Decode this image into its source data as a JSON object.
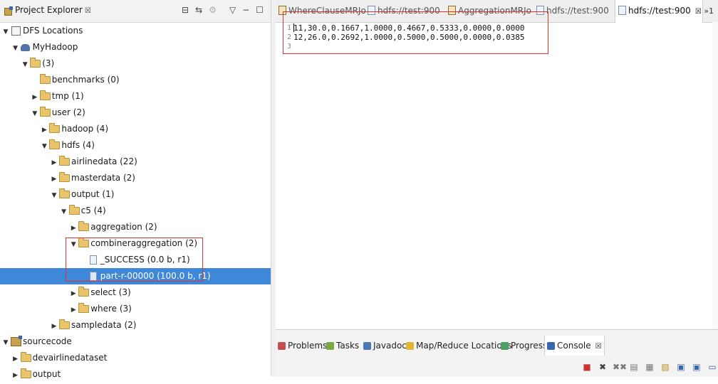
{
  "explorer": {
    "title": "Project Explorer",
    "close_glyph": "☒",
    "tools": [
      "⊟",
      "⇆",
      "⚙",
      "▽",
      "−",
      "☐"
    ],
    "tree": [
      {
        "label": "DFS Locations",
        "depth": 0,
        "twisty": "open",
        "icon": "dfs"
      },
      {
        "label": "MyHadoop",
        "depth": 1,
        "twisty": "open",
        "icon": "elephant"
      },
      {
        "label": "(3)",
        "depth": 2,
        "twisty": "open",
        "icon": "folder"
      },
      {
        "label": "benchmarks (0)",
        "depth": 3,
        "twisty": "none",
        "icon": "folder"
      },
      {
        "label": "tmp (1)",
        "depth": 3,
        "twisty": "closed",
        "icon": "folder"
      },
      {
        "label": "user (2)",
        "depth": 3,
        "twisty": "open",
        "icon": "folder"
      },
      {
        "label": "hadoop (4)",
        "depth": 4,
        "twisty": "closed",
        "icon": "folder"
      },
      {
        "label": "hdfs (4)",
        "depth": 4,
        "twisty": "open",
        "icon": "folder"
      },
      {
        "label": "airlinedata (22)",
        "depth": 5,
        "twisty": "closed",
        "icon": "folder"
      },
      {
        "label": "masterdata (2)",
        "depth": 5,
        "twisty": "closed",
        "icon": "folder"
      },
      {
        "label": "output (1)",
        "depth": 5,
        "twisty": "open",
        "icon": "folder"
      },
      {
        "label": "c5 (4)",
        "depth": 6,
        "twisty": "open",
        "icon": "folder"
      },
      {
        "label": "aggregation (2)",
        "depth": 7,
        "twisty": "closed",
        "icon": "folder"
      },
      {
        "label": "combineraggregation (2)",
        "depth": 7,
        "twisty": "open",
        "icon": "folder"
      },
      {
        "label": "_SUCCESS (0.0 b, r1)",
        "depth": 8,
        "twisty": "none",
        "icon": "file"
      },
      {
        "label": "part-r-00000 (100.0 b, r1)",
        "depth": 8,
        "twisty": "none",
        "icon": "file",
        "selected": true
      },
      {
        "label": "select (3)",
        "depth": 7,
        "twisty": "closed",
        "icon": "folder"
      },
      {
        "label": "where (3)",
        "depth": 7,
        "twisty": "closed",
        "icon": "folder"
      },
      {
        "label": "sampledata (2)",
        "depth": 5,
        "twisty": "closed",
        "icon": "folder"
      },
      {
        "label": "sourcecode",
        "depth": 0,
        "twisty": "open",
        "icon": "project"
      },
      {
        "label": "devairlinedataset",
        "depth": 1,
        "twisty": "closed",
        "icon": "folder"
      },
      {
        "label": "output",
        "depth": 1,
        "twisty": "closed",
        "icon": "folder"
      }
    ]
  },
  "editor": {
    "tabs": [
      {
        "label": "WhereClauseMRJo",
        "icon": "java",
        "active": false
      },
      {
        "label": "hdfs://test:900",
        "icon": "file",
        "active": false
      },
      {
        "label": "AggregationMRJo",
        "icon": "java",
        "active": false
      },
      {
        "label": "hdfs://test:900",
        "icon": "file",
        "active": false
      },
      {
        "label": "hdfs://test:900",
        "icon": "file",
        "active": true
      }
    ],
    "active_close_glyph": "☒",
    "overflow_label": "»1",
    "lines": [
      {
        "num": "1",
        "text": "11,30.0,0.1667,1.0000,0.4667,0.5333,0.0000,0.0000"
      },
      {
        "num": "2",
        "text": "12,26.0,0.2692,1.0000,0.5000,0.5000,0.0000,0.0385"
      },
      {
        "num": "3",
        "text": ""
      }
    ]
  },
  "console": {
    "tabs": [
      {
        "label": "Problems",
        "icon": "problems",
        "active": false
      },
      {
        "label": "Tasks",
        "icon": "tasks",
        "active": false
      },
      {
        "label": "Javadoc",
        "icon": "javadoc",
        "active": false
      },
      {
        "label": "Map/Reduce Locations",
        "icon": "mapreduce",
        "active": false
      },
      {
        "label": "Progress",
        "icon": "progress",
        "active": false
      },
      {
        "label": "Console",
        "icon": "console",
        "active": true
      }
    ],
    "active_close_glyph": "☒",
    "tools": [
      "■",
      "✖",
      "✖✖",
      "▤",
      "▦",
      "▧",
      "▣",
      "▣",
      "▭"
    ]
  },
  "colors": {
    "selection": "#3f87d9",
    "annotation_box": "#dd3333"
  }
}
